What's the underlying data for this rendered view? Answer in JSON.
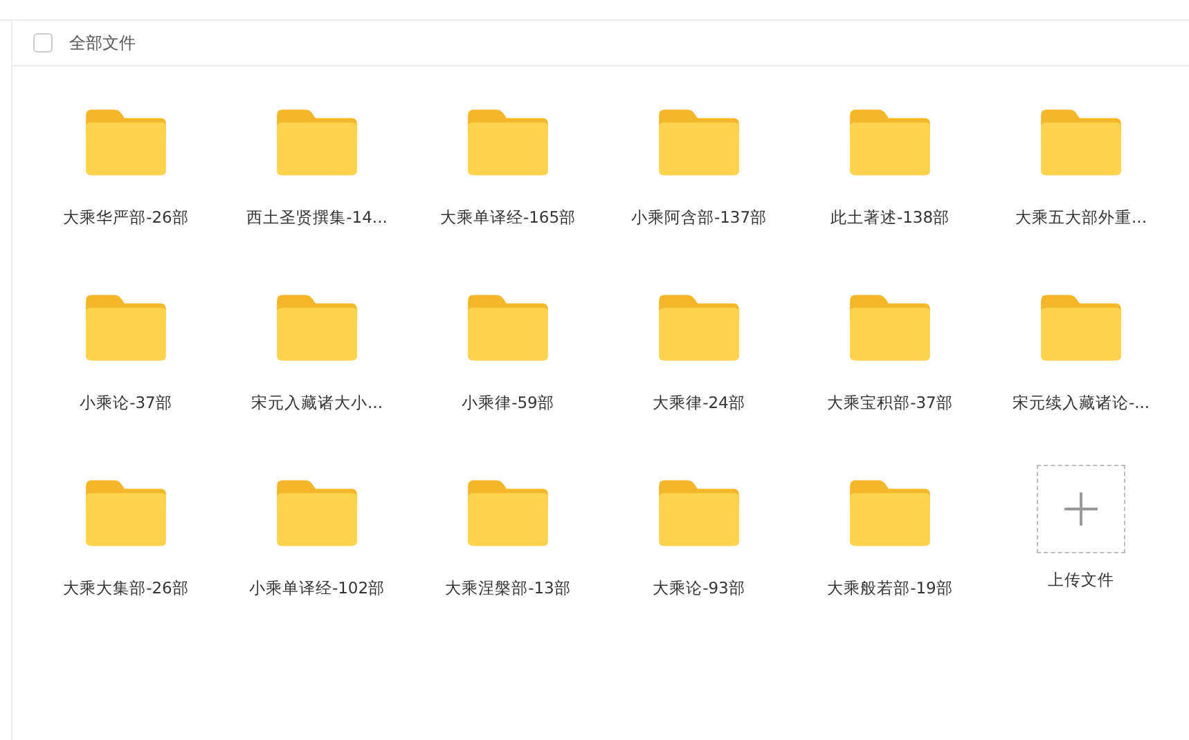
{
  "header": {
    "select_all": {
      "checked": false
    },
    "title": "全部文件"
  },
  "items": [
    {
      "kind": "folder",
      "name": "大乘华严部-26部"
    },
    {
      "kind": "folder",
      "name": "西土圣贤撰集-14..."
    },
    {
      "kind": "folder",
      "name": "大乘单译经-165部"
    },
    {
      "kind": "folder",
      "name": "小乘阿含部-137部"
    },
    {
      "kind": "folder",
      "name": "此土著述-138部"
    },
    {
      "kind": "folder",
      "name": "大乘五大部外重..."
    },
    {
      "kind": "folder",
      "name": "小乘论-37部"
    },
    {
      "kind": "folder",
      "name": "宋元入藏诸大小..."
    },
    {
      "kind": "folder",
      "name": "小乘律-59部"
    },
    {
      "kind": "folder",
      "name": "大乘律-24部"
    },
    {
      "kind": "folder",
      "name": "大乘宝积部-37部"
    },
    {
      "kind": "folder",
      "name": "宋元续入藏诸论-..."
    },
    {
      "kind": "folder",
      "name": "大乘大集部-26部"
    },
    {
      "kind": "folder",
      "name": "小乘单译经-102部"
    },
    {
      "kind": "folder",
      "name": "大乘涅槃部-13部"
    },
    {
      "kind": "folder",
      "name": "大乘论-93部"
    },
    {
      "kind": "folder",
      "name": "大乘般若部-19部"
    },
    {
      "kind": "upload",
      "name": "上传文件"
    }
  ]
}
